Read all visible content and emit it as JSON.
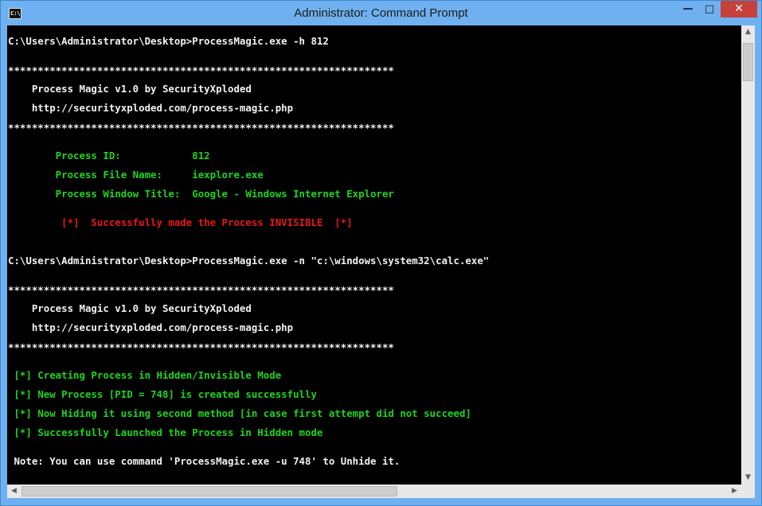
{
  "window": {
    "title": "Administrator: Command Prompt",
    "icon_text": "C:\\",
    "minimize_glyph": "—",
    "maximize_glyph": "□",
    "close_glyph": "✕"
  },
  "console": {
    "lines": [
      {
        "text": "C:\\Users\\Administrator\\Desktop>ProcessMagic.exe -h 812",
        "color": "#f2f2f2"
      },
      {
        "text": "*****************************************************************",
        "color": "#f2f2f2"
      },
      {
        "text": "    Process Magic v1.0 by SecurityXploded",
        "color": "#f2f2f2"
      },
      {
        "text": "    http://securityxploded.com/process-magic.php",
        "color": "#f2f2f2"
      },
      {
        "text": "*****************************************************************",
        "color": "#f2f2f2"
      },
      {
        "text": "        Process ID:            812",
        "color": "#1fd41f"
      },
      {
        "text": "        Process File Name:     iexplore.exe",
        "color": "#1fd41f"
      },
      {
        "text": "        Process Window Title:  Google - Windows Internet Explorer",
        "color": "#1fd41f"
      },
      {
        "text": "         [*]  Successfully made the Process INVISIBLE  [*]",
        "color": "#e81818"
      },
      {
        "text": "C:\\Users\\Administrator\\Desktop>ProcessMagic.exe -n \"c:\\windows\\system32\\calc.exe\"",
        "color": "#f2f2f2"
      },
      {
        "text": "*****************************************************************",
        "color": "#f2f2f2"
      },
      {
        "text": "    Process Magic v1.0 by SecurityXploded",
        "color": "#f2f2f2"
      },
      {
        "text": "    http://securityxploded.com/process-magic.php",
        "color": "#f2f2f2"
      },
      {
        "text": "*****************************************************************",
        "color": "#f2f2f2"
      },
      {
        "text": " [*] Creating Process in Hidden/Invisible Mode",
        "color": "#1fd41f"
      },
      {
        "text": " [*] New Process [PID = 748] is created successfully",
        "color": "#1fd41f"
      },
      {
        "text": " [*] Now Hiding it using second method [in case first attempt did not succeed]",
        "color": "#1fd41f"
      },
      {
        "text": " [*] Successfully Launched the Process in Hidden mode",
        "color": "#1fd41f"
      },
      {
        "text": " Note: You can use command 'ProcessMagic.exe -u 748' to Unhide it.",
        "color": "#f2f2f2"
      }
    ]
  },
  "scrollbars": {
    "up_arrow": "▲",
    "down_arrow": "▼",
    "left_arrow": "◀",
    "right_arrow": "▶"
  },
  "colors": {
    "console_bg": "#000000",
    "default_text": "#f2f2f2",
    "success_text": "#1fd41f",
    "alert_text": "#e81818",
    "titlebar": "#6fb1f0",
    "close_button": "#c7413a"
  }
}
